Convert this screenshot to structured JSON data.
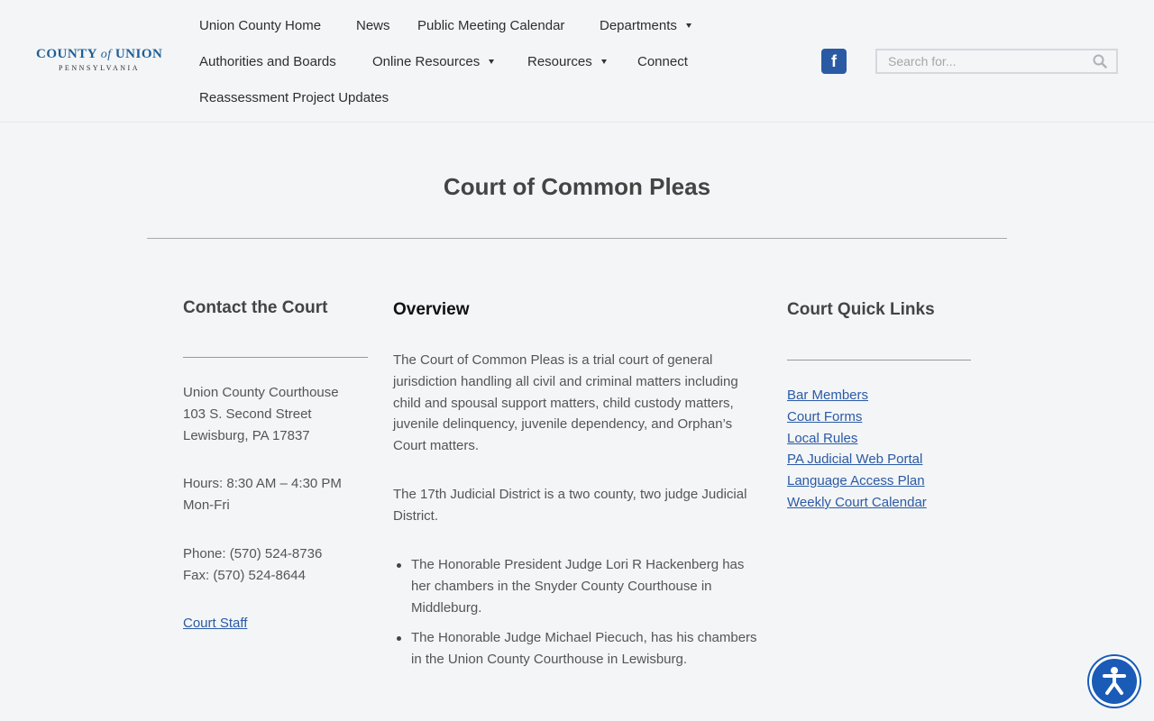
{
  "logo": {
    "county": "COUNTY",
    "of": "of",
    "union": "UNION",
    "state": "PENNSYLVANIA"
  },
  "nav": {
    "union_home": "Union County Home",
    "news": "News",
    "calendar": "Public Meeting Calendar",
    "departments": "Departments",
    "authorities": "Authorities and Boards",
    "online_resources": "Online Resources",
    "resources": "Resources",
    "connect": "Connect",
    "reassessment": "Reassessment Project Updates"
  },
  "search": {
    "placeholder": "Search for..."
  },
  "social": {
    "facebook": "f"
  },
  "page": {
    "title": "Court of Common Pleas"
  },
  "contact": {
    "heading": "Contact the Court",
    "address1": "Union County Courthouse",
    "address2": "103 S. Second Street",
    "address3": "Lewisburg, PA 17837",
    "hours1": "Hours: 8:30 AM – 4:30 PM",
    "hours2": "Mon-Fri",
    "phone": "Phone: (570) 524-8736",
    "fax": "Fax: (570) 524-8644",
    "staff_link": "Court Staff"
  },
  "overview": {
    "heading": "Overview",
    "para1": "The Court of Common Pleas is a trial court of general jurisdiction handling all civil and criminal matters including child and spousal support matters, child custody matters, juvenile delinquency, juvenile dependency, and Orphan’s Court matters.",
    "para2": "The 17th Judicial District is a two county, two judge Judicial District.",
    "bullets": [
      "The Honorable President Judge Lori R Hackenberg has her chambers in the Snyder County Courthouse in Middleburg.",
      "The Honorable Judge Michael Piecuch, has his chambers in the Union County Courthouse in Lewisburg."
    ]
  },
  "quick_links": {
    "heading": "Court Quick Links",
    "items": [
      "Bar Members",
      "Court Forms",
      "Local Rules",
      "PA Judicial Web Portal",
      "Language Access Plan",
      "Weekly Court Calendar"
    ]
  },
  "colors": {
    "brand": "#1f5e95",
    "link": "#2b5aa5",
    "accessibility": "#1a5bb8"
  }
}
